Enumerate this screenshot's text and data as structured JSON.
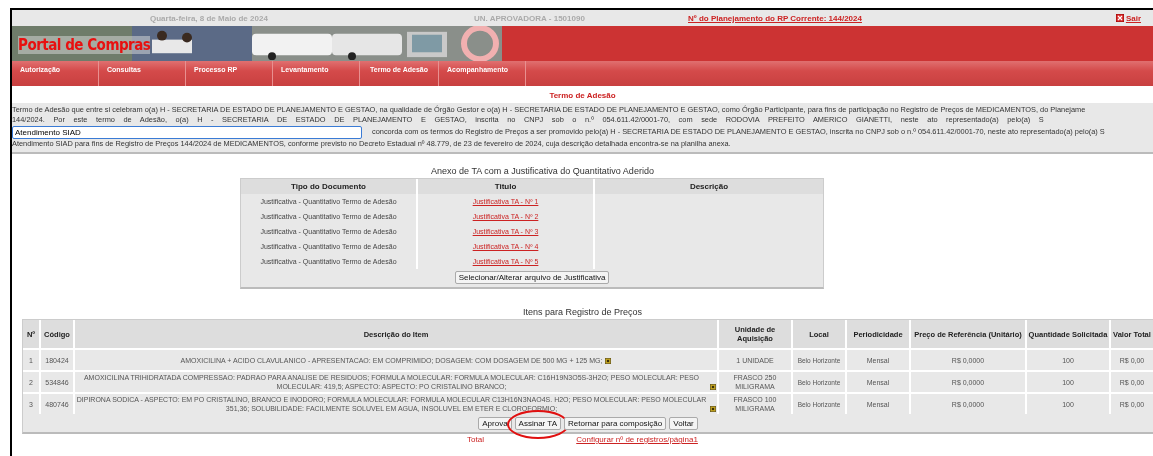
{
  "top_bar": {
    "date": "Quarta-feira, 8 de Maio de 2024",
    "unit": "UN. APROVADORA - 1501090",
    "plan_link": "Nº do Planejamento do RP Corrente: 144/2024",
    "exit_link": "Sair"
  },
  "banner": {
    "logo": "Portal de Compras",
    "kind": "picture"
  },
  "nav": [
    "Autorização",
    "Consultas",
    "Processo RP",
    "Levantamento",
    "Termo de Adesão",
    "Acompanhamento"
  ],
  "page_title": "Termo de Adesão",
  "terms": {
    "line_1": "Termo de Adesão que entre si celebram o(a) H - SECRETARIA DE ESTADO DE PLANEJAMENTO E GESTAO, na qualidade de Órgão Gestor e o(a) H - SECRETARIA DE ESTADO DE PLANEJAMENTO E GESTAO, como Órgão Participante, para fins de participação no Registro de Preços de MEDICAMENTOS, do Planejame",
    "line_2": "144/2024. Por este termo de Adesão, o(a) H - SECRETARIA DE ESTADO DE PLANEJAMENTO E GESTAO, inscrita no CNPJ sob o n.º 054.611.42/0001-70, com sede RODOVIA PREFEITO AMERICO GIANETTI, neste ato representado(a) pelo(a) S",
    "representative_field": {
      "value": "Atendimento SIAD"
    },
    "line_3": "concorda com os termos do Registro de Preços a ser promovido pelo(a) H - SECRETARIA DE ESTADO DE PLANEJAMENTO E GESTAO, inscrita no CNPJ sob o n.º 054.611.42/0001-70, neste ato representado(a) pelo(a) S",
    "line_4": "Atendimento SIAD para fins de Registro de Preços 144/2024 de MEDICAMENTOS, conforme previsto no Decreto Estadual nº 48.779, de 23 de fevereiro de 2024, cuja descrição detalhada encontra-se na planilha anexa."
  },
  "annex": {
    "caption": "Anexo de TA com a Justificativa do Quantitativo Aderido",
    "columns": [
      "Tipo do Documento",
      "Titulo",
      "Descrição"
    ],
    "rows": [
      {
        "type": "Justificativa - Quantitativo Termo de Adesão",
        "title": "Justificativa TA - Nº 1"
      },
      {
        "type": "Justificativa - Quantitativo Termo de Adesão",
        "title": "Justificativa TA - Nº 2"
      },
      {
        "type": "Justificativa - Quantitativo Termo de Adesão",
        "title": "Justificativa TA - Nº 3"
      },
      {
        "type": "Justificativa - Quantitativo Termo de Adesão",
        "title": "Justificativa TA - Nº 4"
      },
      {
        "type": "Justificativa - Quantitativo Termo de Adesão",
        "title": "Justificativa TA - Nº 5"
      }
    ],
    "button": "Selecionar/Alterar arquivo de Justificativa"
  },
  "items": {
    "caption": "Itens para Registro de Preços",
    "columns": [
      "Nº",
      "Código",
      "Descrição do Item",
      "Unidade de Aquisição",
      "Local",
      "Periodicidade",
      "Preço de Referência (Unitário)",
      "Quantidade Solicitada",
      "Valor Total"
    ],
    "rows": [
      {
        "n": "1",
        "code": "180424",
        "description": "AMOXICILINA + ACIDO CLAVULANICO - APRESENTACAO: EM COMPRIMIDO; DOSAGEM: COM DOSAGEM DE 500 MG + 125 MG;",
        "unit": "1 UNIDADE",
        "local": "Belo Horizonte",
        "period": "Mensal",
        "price": "R$ 0,0000",
        "qty": "100",
        "total": "R$ 0,00"
      },
      {
        "n": "2",
        "code": "534846",
        "description": "AMOXICILINA TRIHIDRATADA COMPRESSAO: PADRAO PARA ANALISE DE RESIDUOS; FORMULA MOLECULAR: FORMULA MOLECULAR: C16H19N3O5S-3H2O; PESO MOLECULAR: PESO MOLECULAR: 419,5; ASPECTO: ASPECTO: PO CRISTALINO BRANCO;",
        "unit": "FRASCO 250 MILIGRAMA",
        "local": "Belo Horizonte",
        "period": "Mensal",
        "price": "R$ 0,0000",
        "qty": "100",
        "total": "R$ 0,00"
      },
      {
        "n": "3",
        "code": "480746",
        "description": "DIPIRONA SODICA - ASPECTO: EM PO CRISTALINO, BRANCO E INODORO; FORMULA MOLECULAR: FORMULA MOLECULAR C13H16N3NAO4S. H2O; PESO MOLECULAR: PESO MOLECULAR 351,36; SOLUBILIDADE: FACILMENTE SOLUVEL EM AGUA, INSOLUVEL EM ETER E CLOROFORMIO;",
        "unit": "FRASCO 100 MILIGRAMA",
        "local": "Belo Horizonte",
        "period": "Mensal",
        "price": "R$ 0,0000",
        "qty": "100",
        "total": "R$ 0,00"
      }
    ],
    "buttons": [
      {
        "label": "Aprova",
        "highlighted": false
      },
      {
        "label": "Assinar TA",
        "highlighted": true
      },
      {
        "label": "Retornar para composição",
        "highlighted": false
      },
      {
        "label": "Voltar",
        "highlighted": false
      }
    ]
  },
  "footer": {
    "total": "Total",
    "config_link": "Configurar nº de registros/página1"
  }
}
